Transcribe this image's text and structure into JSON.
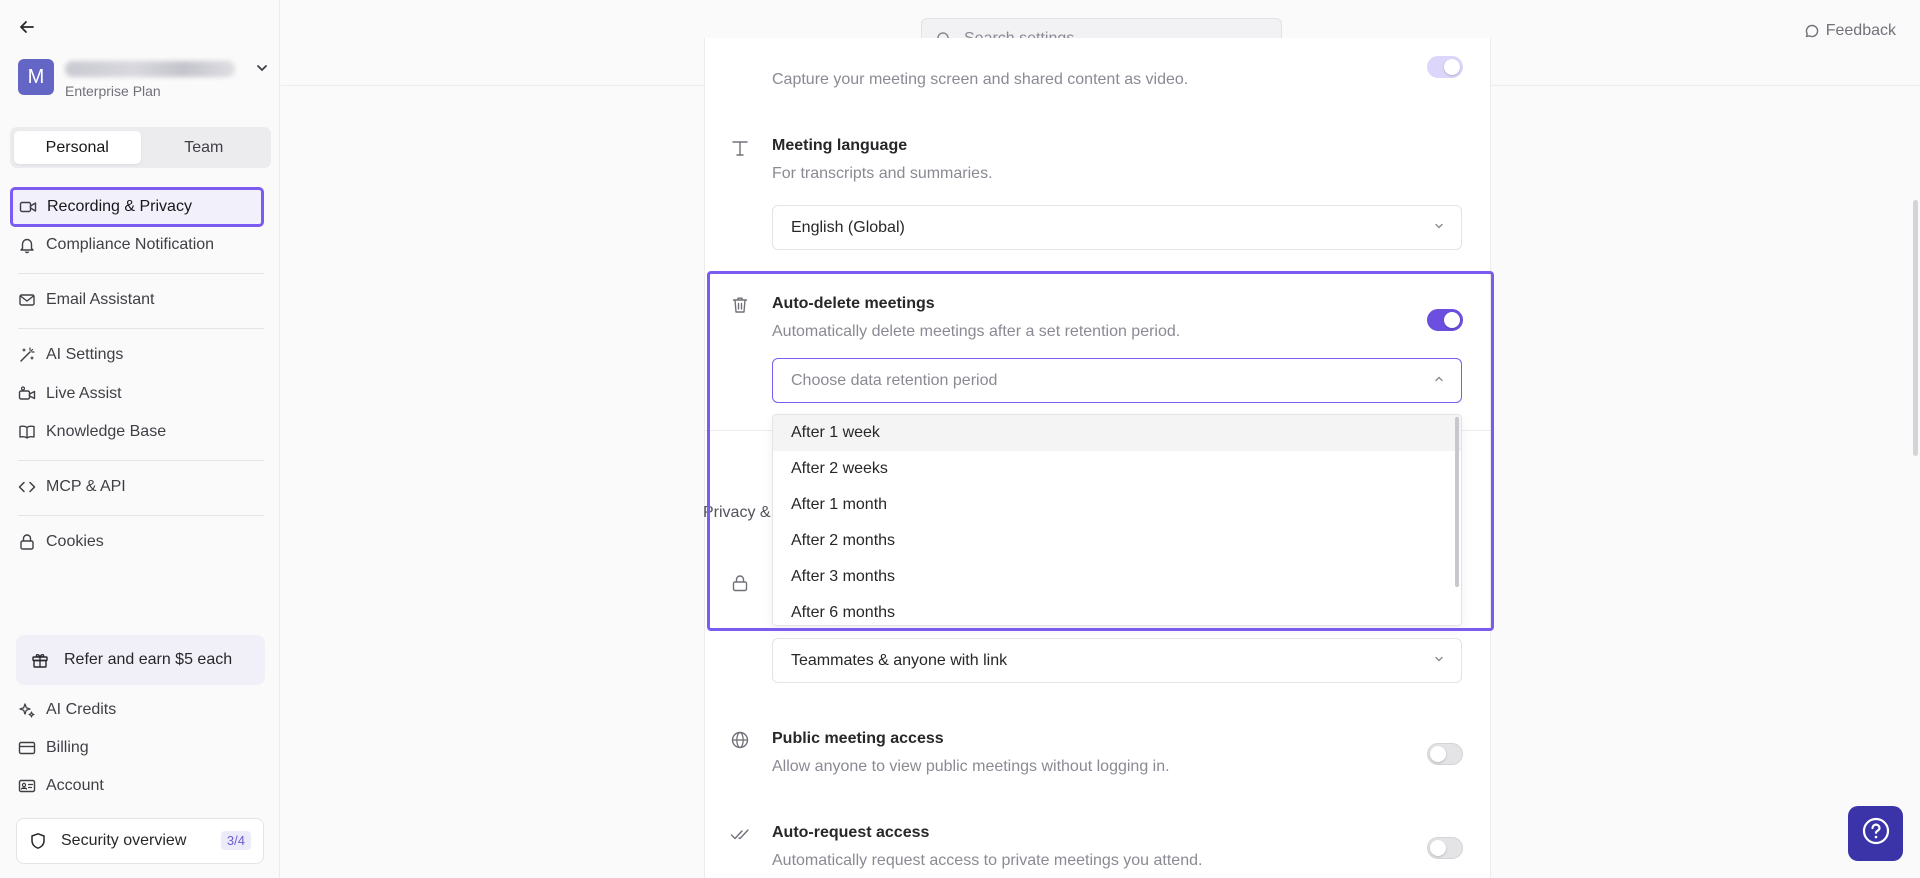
{
  "sidebar": {
    "account": {
      "avatar_letter": "M",
      "plan": "Enterprise Plan"
    },
    "tabs": {
      "personal": "Personal",
      "team": "Team"
    },
    "items": {
      "recording_privacy": "Recording & Privacy",
      "compliance_notification": "Compliance Notification",
      "email_assistant": "Email Assistant",
      "ai_settings": "AI Settings",
      "live_assist": "Live Assist",
      "knowledge_base": "Knowledge Base",
      "mcp_api": "MCP & API",
      "cookies": "Cookies"
    },
    "refer": "Refer and earn $5 each",
    "bottom_items": {
      "ai_credits": "AI Credits",
      "billing": "Billing",
      "account": "Account"
    },
    "security_overview": {
      "label": "Security overview",
      "badge": "3/4"
    }
  },
  "topbar": {
    "search_placeholder": "Search settings",
    "feedback": "Feedback"
  },
  "settings": {
    "video_recording": {
      "description": "Capture your meeting screen and shared content as video."
    },
    "meeting_language": {
      "title": "Meeting language",
      "description": "For transcripts and summaries.",
      "value": "English (Global)"
    },
    "auto_delete": {
      "title": "Auto-delete meetings",
      "description": "Automatically delete meetings after a set retention period.",
      "placeholder": "Choose data retention period",
      "enabled": true
    },
    "section_label": "Privacy &",
    "default_access": {
      "value": "Teammates & anyone with link"
    },
    "public_access": {
      "title": "Public meeting access",
      "description": "Allow anyone to view public meetings without logging in.",
      "enabled": false
    },
    "auto_request": {
      "title": "Auto-request access",
      "description": "Automatically request access to private meetings you attend.",
      "enabled": false
    }
  },
  "retention_options": [
    "After 1 week",
    "After 2 weeks",
    "After 1 month",
    "After 2 months",
    "After 3 months",
    "After 6 months"
  ],
  "colors": {
    "accent": "#6d4fe0",
    "highlight": "#7c5cf0",
    "avatar": "#6366c4",
    "help_button": "#3b34a8"
  }
}
